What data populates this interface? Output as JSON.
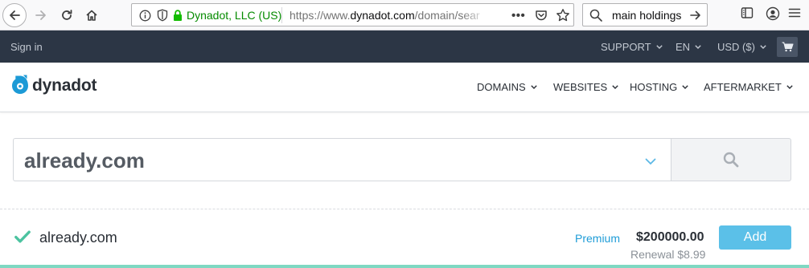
{
  "browser": {
    "identity_label": "Dynadot, LLC (US)",
    "url_prefix": "https://www.",
    "url_host": "dynadot.com",
    "url_path": "/domain/sear",
    "more_label": "•••",
    "search_value": "main holdings"
  },
  "topbar": {
    "sign_in": "Sign in",
    "support": "SUPPORT",
    "language": "EN",
    "currency": "USD ($)"
  },
  "header": {
    "brand": "dynadot",
    "menu": [
      {
        "label": "DOMAINS"
      },
      {
        "label": "WEBSITES"
      },
      {
        "label": "HOSTING"
      },
      {
        "label": "AFTERMARKET"
      }
    ]
  },
  "search": {
    "value": "already.com"
  },
  "result": {
    "domain": "already.com",
    "badge": "Premium",
    "price": "$200000.00",
    "renewal": "Renewal $8.99",
    "add_label": "Add"
  },
  "colors": {
    "topbar_bg": "#2c3645",
    "accent_blue": "#5bc0e8",
    "premium_blue": "#1e9cd7",
    "check_green": "#4cc3a0",
    "secure_green": "#058b00"
  },
  "icons": {
    "back": "arrow-left-icon",
    "forward": "arrow-right-icon",
    "reload": "reload-icon",
    "home": "home-icon",
    "cart": "cart-icon",
    "search": "search-icon",
    "check": "check-icon"
  }
}
